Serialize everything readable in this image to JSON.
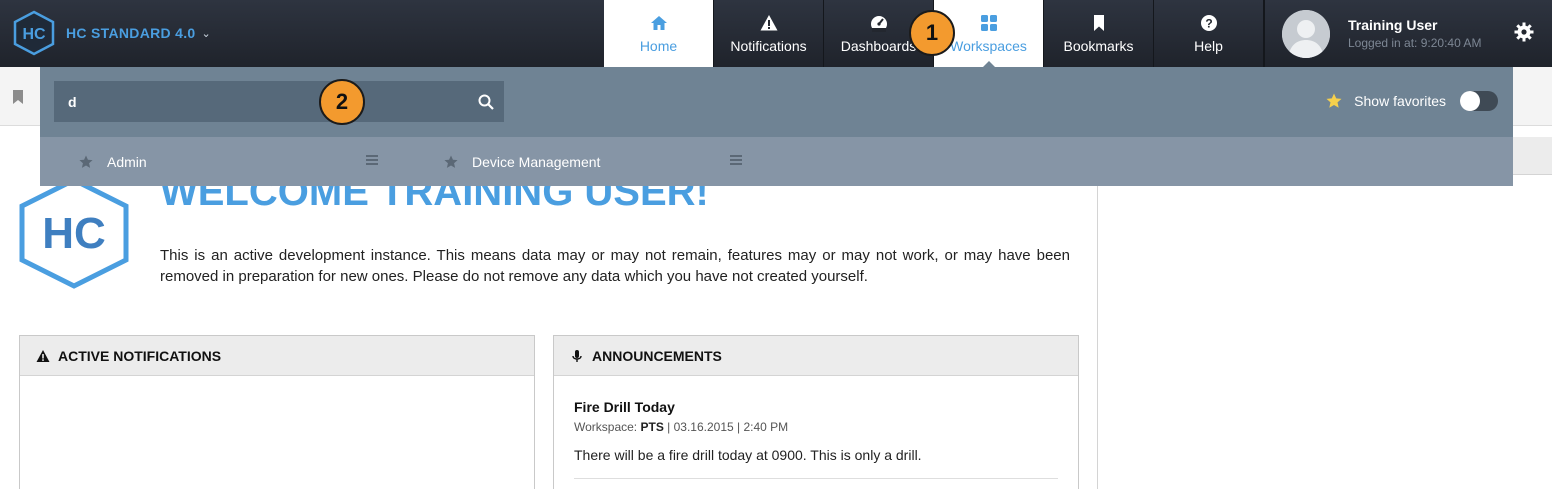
{
  "brand": {
    "name": "HC STANDARD 4.0",
    "logo_text": "HC"
  },
  "nav": {
    "home": "Home",
    "notifications": "Notifications",
    "dashboards": "Dashboards",
    "workspaces": "Workspaces",
    "bookmarks": "Bookmarks",
    "help": "Help"
  },
  "user": {
    "name": "Training User",
    "login": "Logged in at: 9:20:40 AM"
  },
  "callouts": {
    "one": "1",
    "two": "2"
  },
  "workspace_dropdown": {
    "search_value": "d",
    "show_favorites_label": "Show favorites",
    "show_favorites_on": false,
    "items": [
      {
        "label": "Admin"
      },
      {
        "label": "Device Management"
      }
    ]
  },
  "main": {
    "welcome": "WELCOME TRAINING USER!",
    "intro": "This is an active development instance. This means data may or may not remain, features may or may not work, or may have been removed in preparation for new ones. Please do not remove any data which you have not created yourself."
  },
  "notifications_panel": {
    "title": "ACTIVE NOTIFICATIONS"
  },
  "announcements_panel": {
    "title": "ANNOUNCEMENTS",
    "item": {
      "title": "Fire Drill Today",
      "workspace_label": "Workspace:",
      "workspace": "PTS",
      "datetime": "| 03.16.2015 | 2:40 PM",
      "body": "There will be a fire drill today at 0900. This is only a drill."
    }
  },
  "colors": {
    "accent": "#4a9ee0",
    "topbar": "#2e3440",
    "dropdown": "#6f8394",
    "callout": "#f39a2e"
  }
}
